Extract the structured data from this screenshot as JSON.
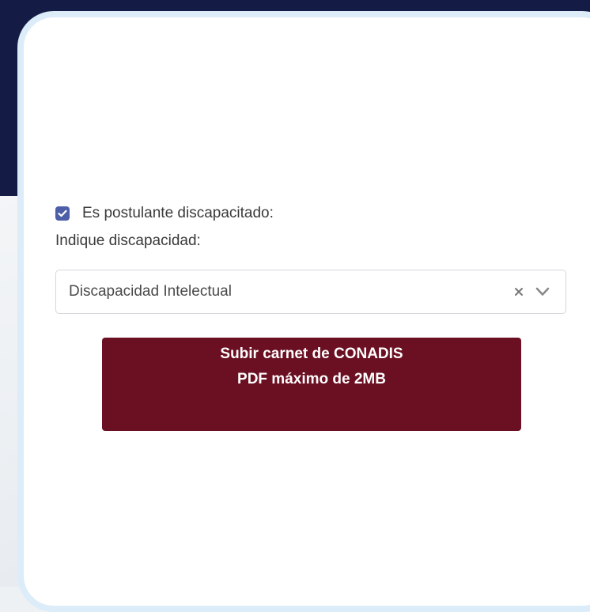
{
  "form": {
    "disability_checkbox": {
      "checked": true,
      "label": "Es postulante discapacitado:"
    },
    "disability_field_label": "Indique discapacidad:",
    "disability_select": {
      "selected_value": "Discapacidad Intelectual",
      "clear_icon": "close-icon",
      "dropdown_icon": "chevron-down-icon"
    },
    "upload_button": {
      "line1": "Subir carnet de CONADIS",
      "line2": "PDF máximo de 2MB"
    }
  },
  "colors": {
    "header_background": "#141b44",
    "checkbox_accent": "#4d5ea8",
    "upload_button_background": "#6b0f22",
    "card_border": "#dcecf9"
  }
}
